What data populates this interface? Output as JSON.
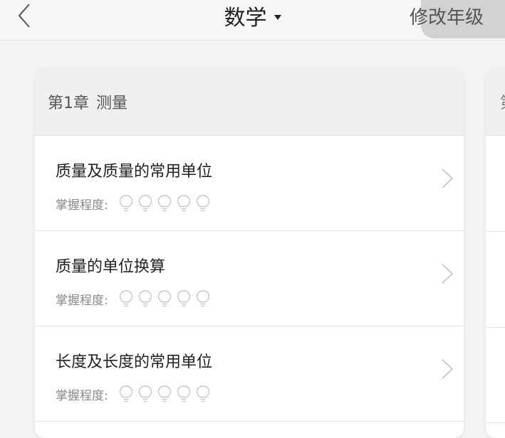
{
  "navbar": {
    "title": "数学",
    "edit_grade_label": "修改年级",
    "back_icon": "chevron-left-icon",
    "title_dropdown_icon": "caret-down-icon"
  },
  "chapter": {
    "number_label": "第1章",
    "name": "测量",
    "lessons": [
      {
        "title": "质量及质量的常用单位",
        "mastery_label": "掌握程度:",
        "mastery_level": 0,
        "mastery_max": 5
      },
      {
        "title": "质量的单位换算",
        "mastery_label": "掌握程度:",
        "mastery_level": 0,
        "mastery_max": 5
      },
      {
        "title": "长度及长度的常用单位",
        "mastery_label": "掌握程度:",
        "mastery_level": 0,
        "mastery_max": 5
      }
    ]
  },
  "next_chapter_peek": {
    "number_char": "第"
  },
  "colors": {
    "background": "#f4f4f4",
    "card": "#ffffff",
    "header": "#f0f0f0",
    "icon_gray": "#c8c8c8"
  }
}
